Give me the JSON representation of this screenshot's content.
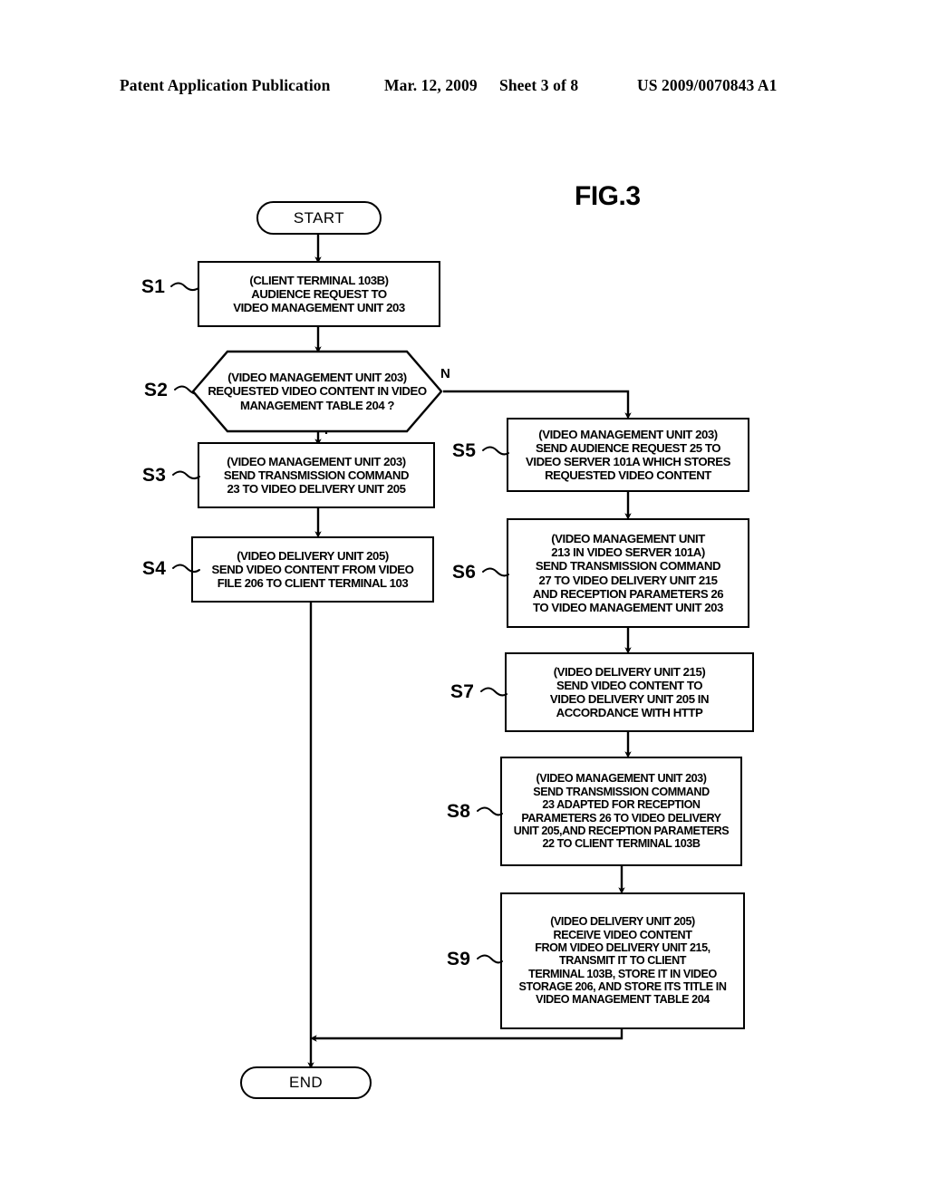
{
  "header": {
    "publication": "Patent Application Publication",
    "date": "Mar. 12, 2009",
    "sheet": "Sheet 3 of 8",
    "patent_number": "US 2009/0070843 A1"
  },
  "figure": {
    "title": "FIG.3"
  },
  "flow": {
    "start_label": "START",
    "end_label": "END",
    "branch_no": "N",
    "branch_yes": "Y",
    "steps": [
      {
        "id": "S1",
        "label": "S1",
        "lines": [
          "(CLIENT TERMINAL 103B)",
          "AUDIENCE REQUEST TO",
          "VIDEO MANAGEMENT UNIT 203"
        ]
      },
      {
        "id": "S2",
        "label": "S2",
        "lines": [
          "(VIDEO MANAGEMENT UNIT 203)",
          "REQUESTED VIDEO CONTENT IN",
          "VIDEO MANAGEMENT TABLE 204 ?"
        ]
      },
      {
        "id": "S3",
        "label": "S3",
        "lines": [
          "(VIDEO MANAGEMENT UNIT 203)",
          "SEND TRANSMISSION COMMAND",
          "23 TO VIDEO DELIVERY UNIT 205"
        ]
      },
      {
        "id": "S4",
        "label": "S4",
        "lines": [
          "(VIDEO DELIVERY UNIT 205)",
          "SEND VIDEO CONTENT FROM VIDEO",
          "FILE 206 TO CLIENT TERMINAL 103"
        ]
      },
      {
        "id": "S5",
        "label": "S5",
        "lines": [
          "(VIDEO MANAGEMENT UNIT 203)",
          "SEND AUDIENCE REQUEST 25 TO",
          "VIDEO SERVER 101A WHICH STORES",
          "REQUESTED VIDEO CONTENT"
        ]
      },
      {
        "id": "S6",
        "label": "S6",
        "lines": [
          "(VIDEO MANAGEMENT UNIT",
          "213 IN VIDEO SERVER 101A)",
          "SEND TRANSMISSION COMMAND",
          "27 TO VIDEO DELIVERY UNIT 215",
          "AND RECEPTION PARAMETERS 26",
          "TO VIDEO MANAGEMENT UNIT 203"
        ]
      },
      {
        "id": "S7",
        "label": "S7",
        "lines": [
          "(VIDEO DELIVERY UNIT 215)",
          "SEND VIDEO CONTENT TO",
          "VIDEO DELIVERY UNIT 205 IN",
          "ACCORDANCE WITH HTTP"
        ]
      },
      {
        "id": "S8",
        "label": "S8",
        "lines": [
          "(VIDEO MANAGEMENT UNIT 203)",
          "SEND TRANSMISSION COMMAND",
          "23 ADAPTED FOR RECEPTION",
          "PARAMETERS 26 TO VIDEO DELIVERY",
          "UNIT 205,AND RECEPTION PARAMETERS",
          "22 TO CLIENT TERMINAL 103B"
        ]
      },
      {
        "id": "S9",
        "label": "S9",
        "lines": [
          "(VIDEO DELIVERY UNIT 205)",
          "RECEIVE VIDEO CONTENT",
          "FROM VIDEO DELIVERY UNIT 215,",
          "TRANSMIT IT TO CLIENT",
          "TERMINAL 103B, STORE IT IN VIDEO",
          "STORAGE 206, AND STORE ITS TITLE IN",
          "VIDEO MANAGEMENT TABLE 204"
        ]
      }
    ]
  }
}
